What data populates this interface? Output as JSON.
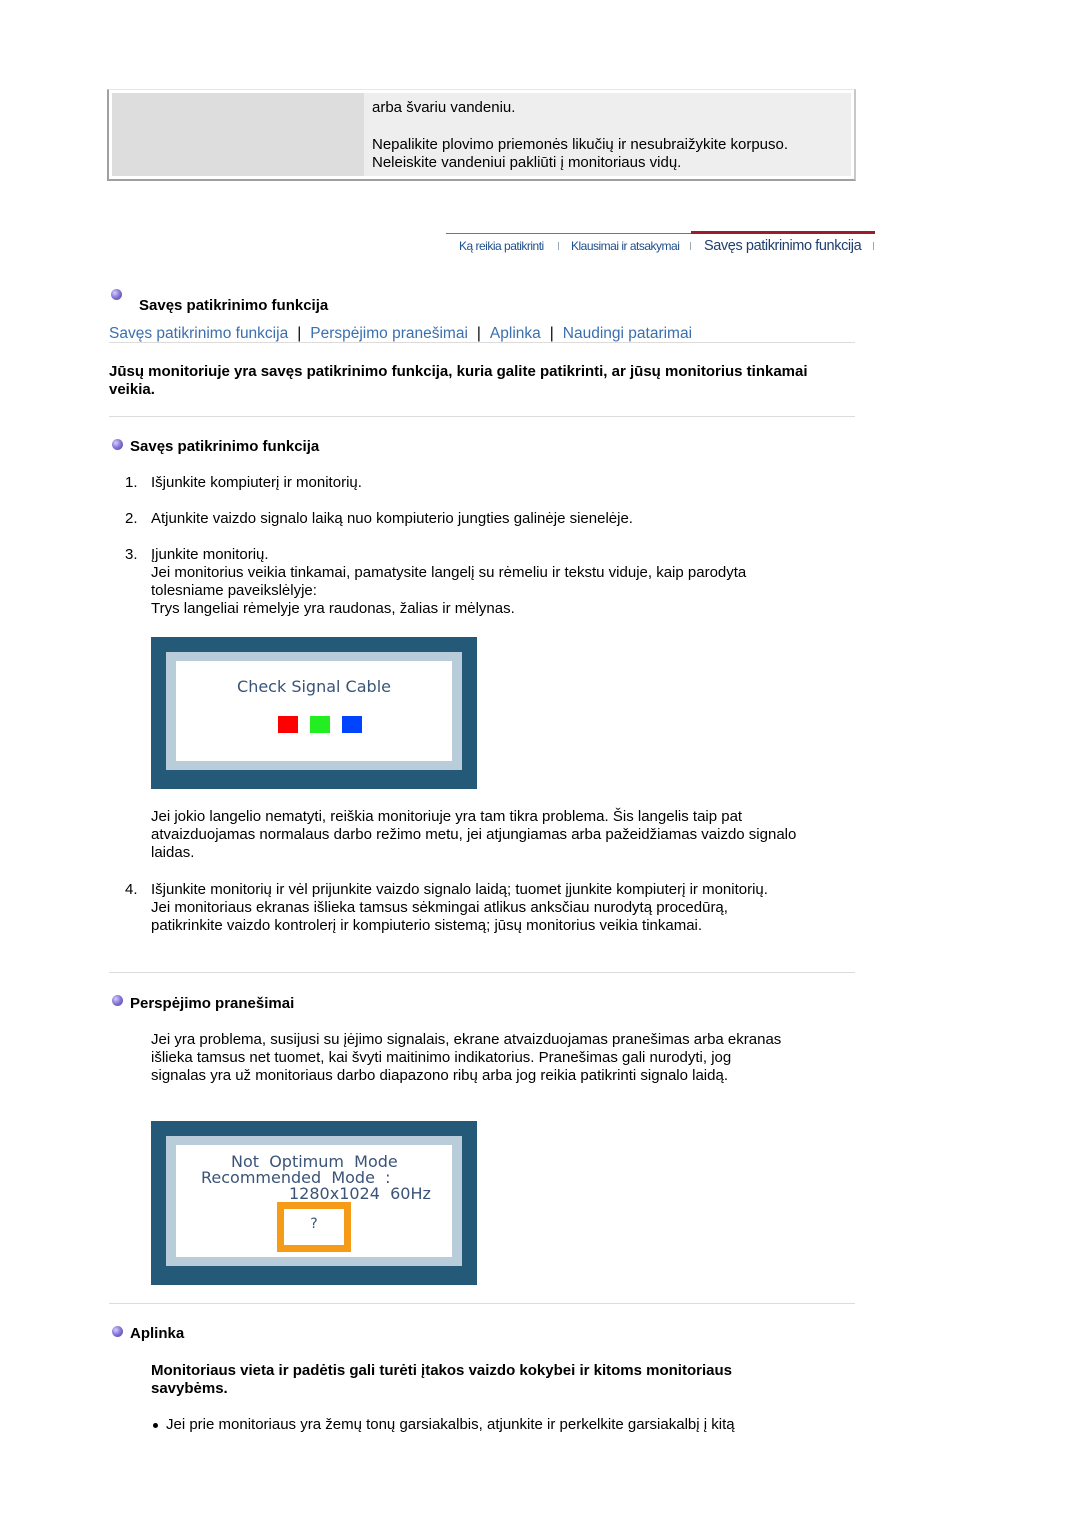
{
  "top_table": {
    "line1": "arba švariu vandeniu.",
    "line2": "Nepalikite plovimo priemonės likučių ir nesubraižykite korpuso.",
    "line3": "Neleiskite vandeniui pakliūti į monitoriaus vidų."
  },
  "tabs": [
    {
      "label": "Ką reikia patikrinti",
      "active": false
    },
    {
      "label": "Klausimai ir atsakymai",
      "active": false
    },
    {
      "label": "Savęs patikrinimo funkcija",
      "active": true
    }
  ],
  "page_title": "Savęs patikrinimo funkcija",
  "nav_links": [
    {
      "label": "Savęs patikrinimo funkcija"
    },
    {
      "label": "Perspėjimo pranešimai"
    },
    {
      "label": "Aplinka"
    },
    {
      "label": "Naudingi patarimai"
    }
  ],
  "nav_separator": "|",
  "intro": "Jūsų monitoriuje yra savęs patikrinimo funkcija, kuria galite patikrinti, ar jūsų monitorius tinkamai veikia.",
  "section1": {
    "title": "Savęs patikrinimo funkcija",
    "steps": [
      {
        "num": "1.",
        "lines": [
          "Išjunkite kompiuterį ir monitorių."
        ]
      },
      {
        "num": "2.",
        "lines": [
          "Atjunkite vaizdo signalo laiką nuo kompiuterio jungties galinėje sienelėje."
        ]
      },
      {
        "num": "3.",
        "lines": [
          "Įjunkite monitorių.",
          "Jei monitorius veikia tinkamai, pamatysite langelį su rėmeliu ir tekstu viduje, kaip parodyta tolesniame paveikslėlyje:",
          "Trys langeliai rėmelyje yra raudonas, žalias ir mėlynas."
        ]
      },
      {
        "num": "4.",
        "lines": [
          "Išjunkite monitorių ir vėl prijunkite vaizdo signalo laidą; tuomet įjunkite kompiuterį ir monitorių.",
          "Jei monitoriaus ekranas išlieka tamsus sėkmingai atlikus anksčiau nurodytą procedūrą, patikrinkite vaizdo kontrolerį ir kompiuterio sistemą; jūsų monitorius veikia tinkamai."
        ]
      }
    ],
    "screen1": {
      "message": "Check Signal Cable",
      "squares": [
        "#ff0000",
        "#22ee22",
        "#0044ff"
      ]
    },
    "after_screen": "Jei jokio langelio nematyti, reiškia monitoriuje yra tam tikra problema. Šis langelis taip pat atvaizduojamas normalaus darbo režimo metu, jei atjungiamas arba pažeidžiamas vaizdo signalo laidas."
  },
  "section2": {
    "title": "Perspėjimo pranešimai",
    "text": "Jei yra problema, susijusi su įėjimo signalais, ekrane atvaizduojamas pranešimas arba ekranas išlieka tamsus net tuomet, kai švyti maitinimo indikatorius. Pranešimas gali nurodyti, jog signalas yra už monitoriaus darbo diapazono ribų arba jog reikia patikrinti signalo laidą.",
    "screen2": {
      "line1": "Not  Optimum  Mode",
      "line2": "Recommended  Mode  :",
      "line3": "1280x1024  60Hz",
      "box_text": "?",
      "box_color": "#f59b18"
    }
  },
  "section3": {
    "title": "Aplinka",
    "bold_text": "Monitoriaus vieta ir padėtis gali turėti įtakos vaizdo kokybei ir kitoms monitoriaus savybėms.",
    "bullets": [
      "Jei prie monitoriaus yra žemų tonų garsiakalbis, atjunkite ir perkelkite garsiakalbį į kitą"
    ]
  },
  "colors": {
    "link": "#3a6fb0",
    "tab_active_underline": "#9b1c2a",
    "screen_frame": "#245a78"
  }
}
